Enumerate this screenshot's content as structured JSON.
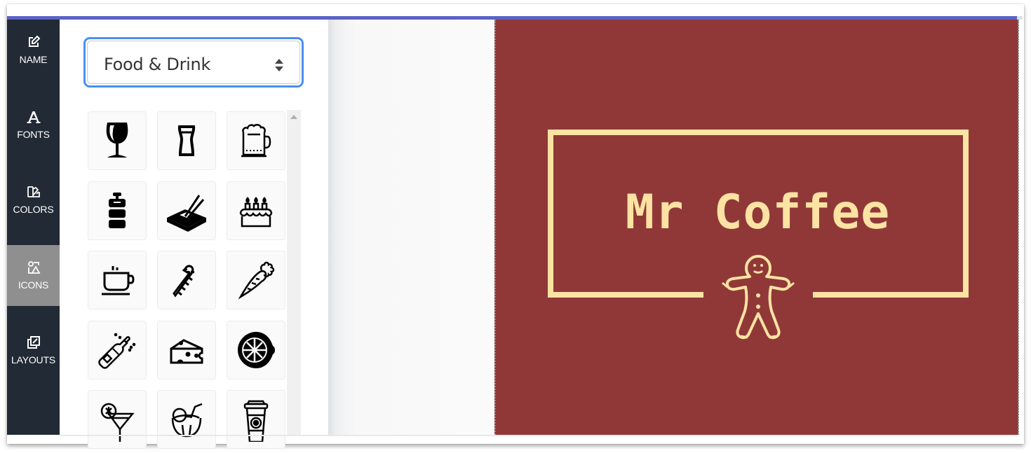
{
  "sidebar": {
    "items": [
      {
        "label": "NAME",
        "icon": "edit-icon",
        "active": false
      },
      {
        "label": "FONTS",
        "icon": "font-icon",
        "active": false
      },
      {
        "label": "COLORS",
        "icon": "palette-icon",
        "active": false
      },
      {
        "label": "ICONS",
        "icon": "shapes-icon",
        "active": true
      },
      {
        "label": "LAYOUTS",
        "icon": "layouts-icon",
        "active": false
      }
    ]
  },
  "icon_panel": {
    "category_select": {
      "value": "Food & Drink"
    },
    "icons": [
      "wine-glass-icon",
      "beer-glass-icon",
      "beer-mug-icon",
      "keg-icon",
      "sushi-chopsticks-icon",
      "birthday-cake-icon",
      "coffee-cup-icon",
      "candy-cane-icon",
      "carrot-icon",
      "champagne-bottle-icon",
      "cheese-icon",
      "lemon-slice-icon",
      "cocktail-icon",
      "coconut-drink-icon",
      "takeaway-coffee-icon"
    ]
  },
  "logo_preview": {
    "title": "Mr Coffee",
    "icon": "gingerbread-man-icon",
    "background_color": "#903838",
    "foreground_color": "#fde3a3"
  },
  "colors": {
    "accent_bar": "#5b63c6",
    "sidebar_bg": "#212a35",
    "sidebar_active": "#8f8f8f",
    "select_focus": "#4a8ff0"
  }
}
